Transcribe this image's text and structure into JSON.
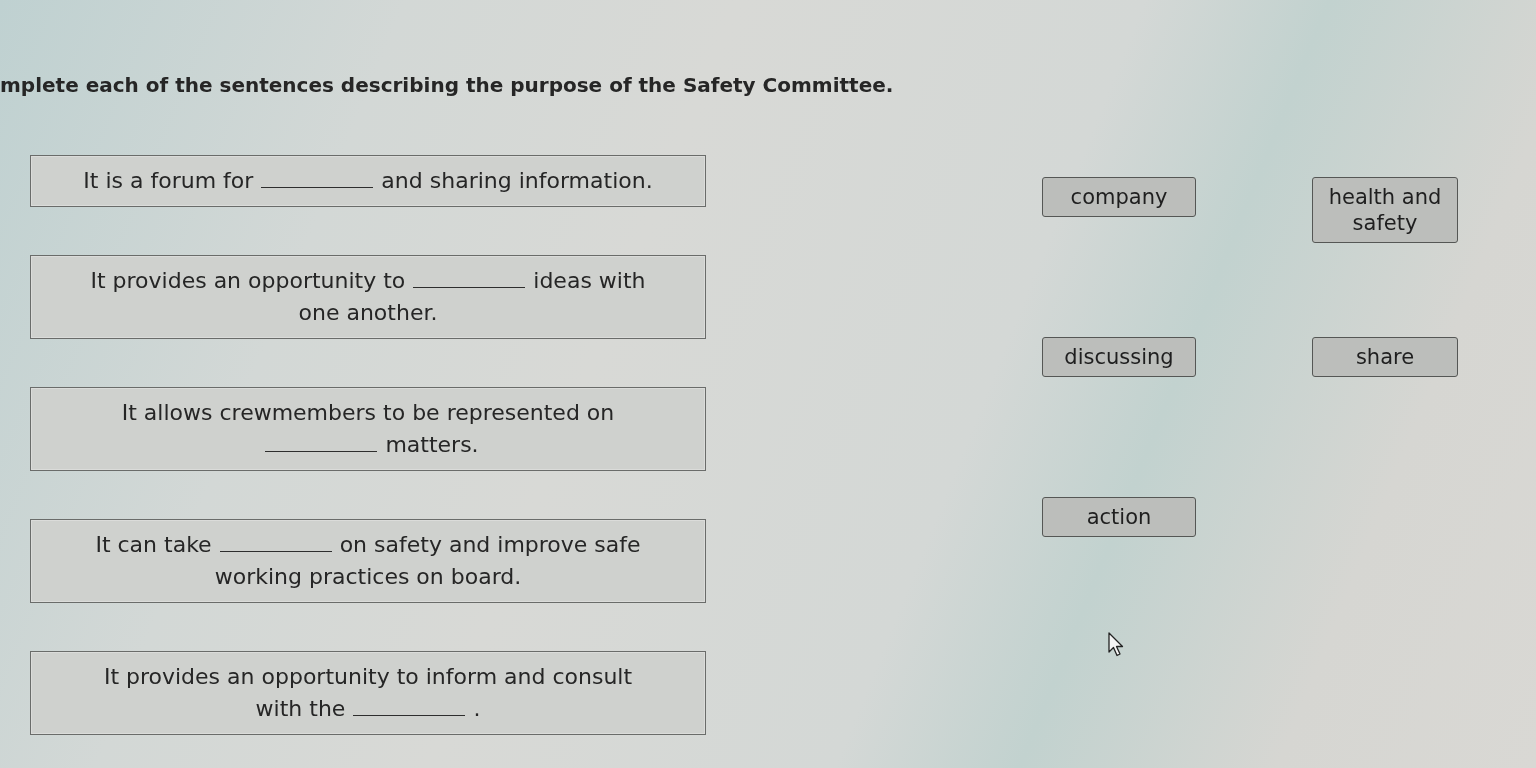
{
  "instruction": "mplete each of the sentences describing the purpose of the Safety Committee.",
  "sentences": [
    {
      "lines": [
        [
          {
            "kind": "text",
            "text": "It is a forum for"
          },
          {
            "kind": "blank"
          },
          {
            "kind": "text",
            "text": "and sharing information."
          }
        ]
      ]
    },
    {
      "lines": [
        [
          {
            "kind": "text",
            "text": "It provides an opportunity to"
          },
          {
            "kind": "blank"
          },
          {
            "kind": "text",
            "text": "ideas with"
          }
        ],
        [
          {
            "kind": "text",
            "text": "one another."
          }
        ]
      ]
    },
    {
      "lines": [
        [
          {
            "kind": "text",
            "text": "It allows crewmembers to be represented on"
          }
        ],
        [
          {
            "kind": "blank"
          },
          {
            "kind": "text",
            "text": "matters."
          }
        ]
      ]
    },
    {
      "lines": [
        [
          {
            "kind": "text",
            "text": "It can take"
          },
          {
            "kind": "blank"
          },
          {
            "kind": "text",
            "text": "on safety and improve safe"
          }
        ],
        [
          {
            "kind": "text",
            "text": "working practices on board."
          }
        ]
      ]
    },
    {
      "lines": [
        [
          {
            "kind": "text",
            "text": "It provides an opportunity to inform and consult"
          }
        ],
        [
          {
            "kind": "text",
            "text": "with the"
          },
          {
            "kind": "blank"
          },
          {
            "kind": "text",
            "text": "."
          }
        ]
      ]
    }
  ],
  "word_bank": [
    "company",
    "health and safety",
    "discussing",
    "share",
    "action"
  ]
}
